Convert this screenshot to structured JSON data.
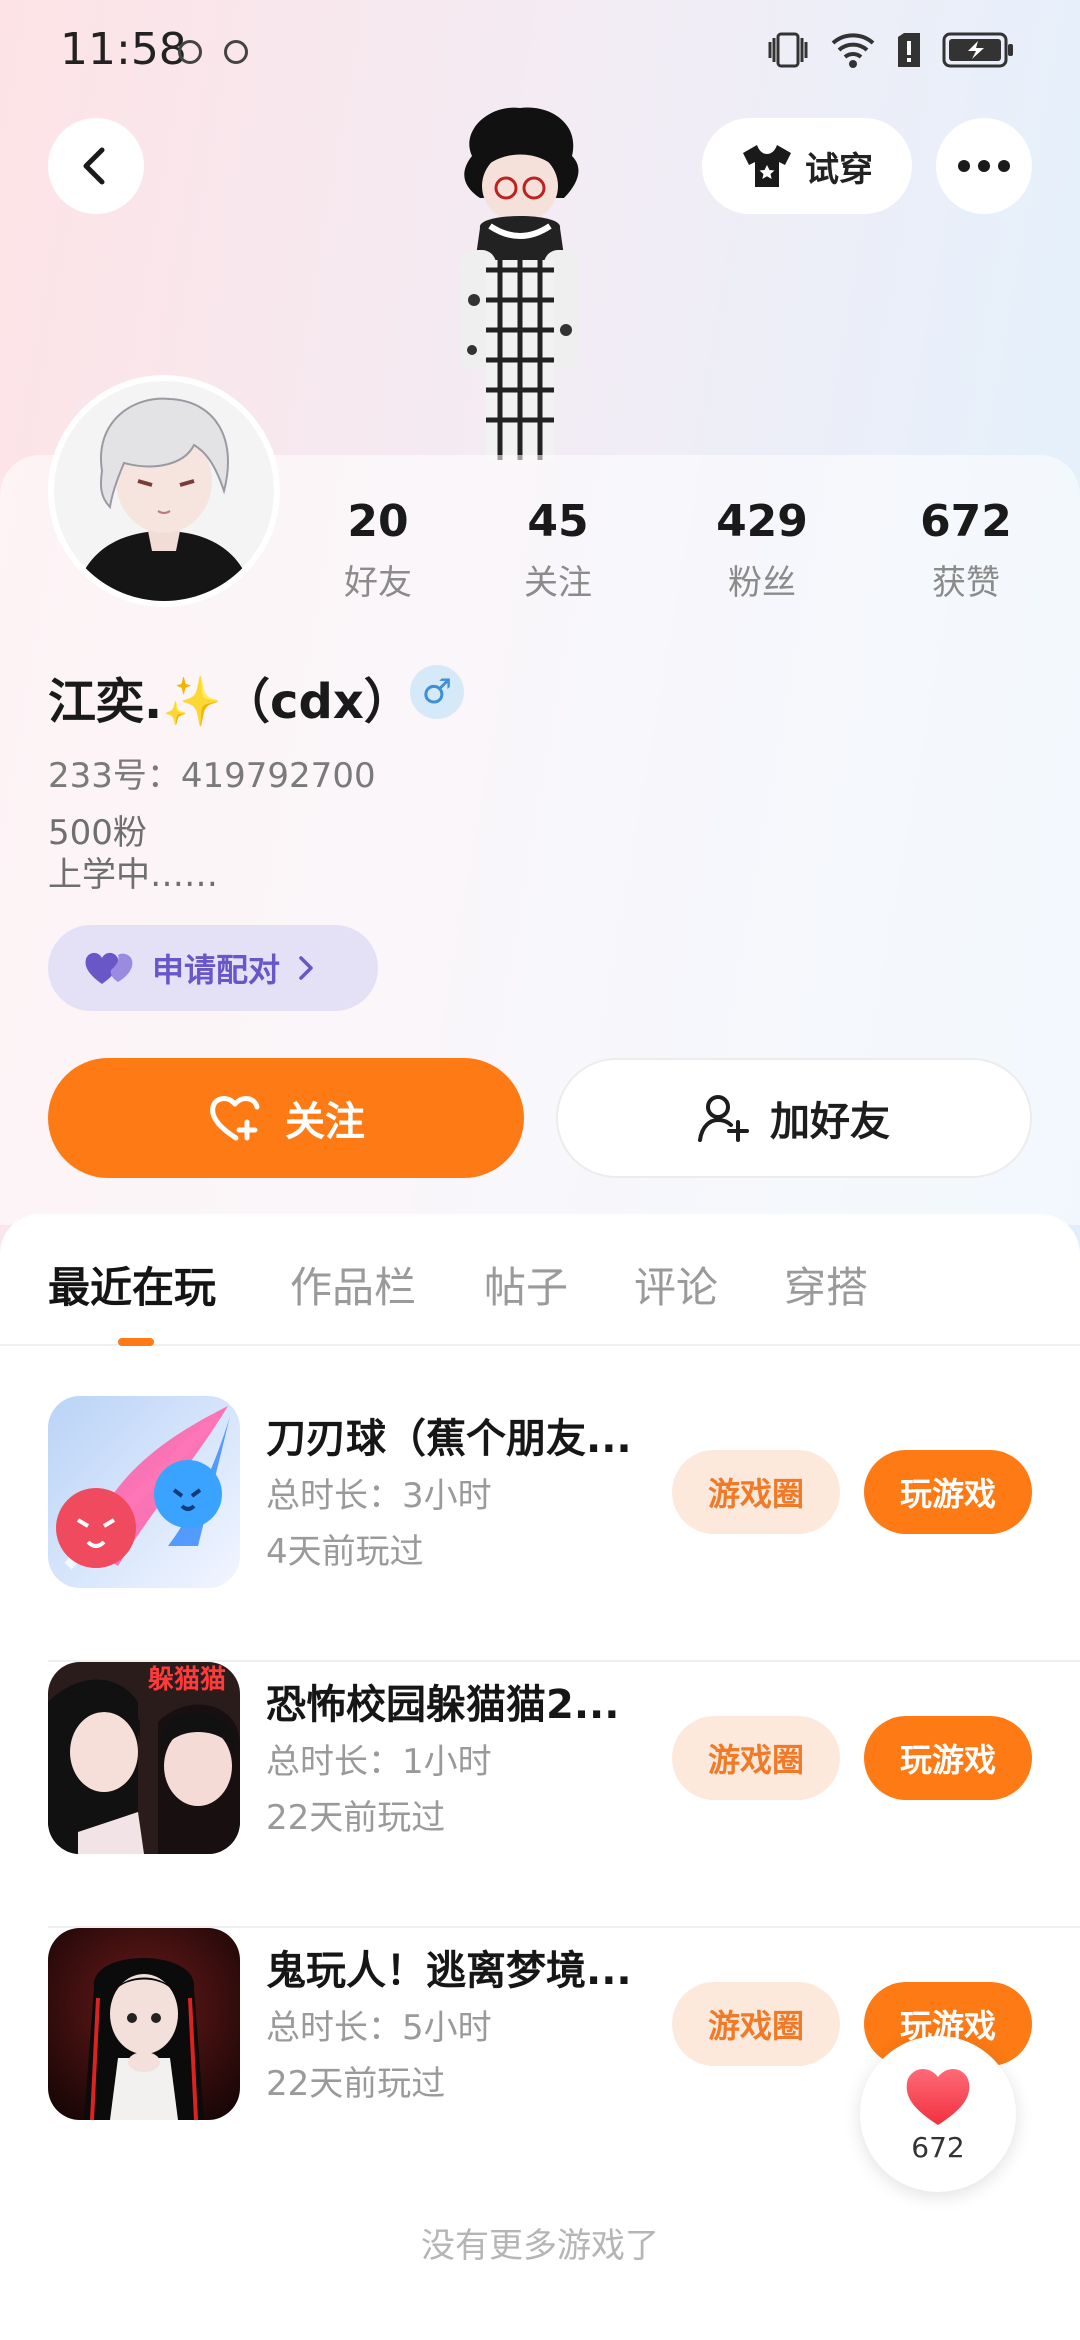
{
  "status_bar": {
    "time": "11:58"
  },
  "header": {
    "try_on_label": "试穿"
  },
  "stats": [
    {
      "value": "20",
      "label": "好友"
    },
    {
      "value": "45",
      "label": "关注"
    },
    {
      "value": "429",
      "label": "粉丝"
    },
    {
      "value": "672",
      "label": "获赞"
    }
  ],
  "profile": {
    "nickname": "江奕.✨（cdx）",
    "gender_symbol": "♂",
    "uid": "233号：419792700",
    "bio_line1": "500粉",
    "bio_line2": "上学中……",
    "pair_label": "申请配对"
  },
  "actions": {
    "follow_label": "关注",
    "add_friend_label": "加好友"
  },
  "tabs": [
    {
      "label": "最近在玩",
      "active": true
    },
    {
      "label": "作品栏",
      "active": false
    },
    {
      "label": "帖子",
      "active": false
    },
    {
      "label": "评论",
      "active": false
    },
    {
      "label": "穿搭",
      "active": false
    }
  ],
  "games": [
    {
      "title": "刀刃球（蕉个朋友...",
      "duration": "总时长：3小时",
      "last_played": "4天前玩过",
      "circle_label": "游戏圈",
      "play_label": "玩游戏"
    },
    {
      "title": "恐怖校园躲猫猫2...",
      "duration": "总时长：1小时",
      "last_played": "22天前玩过",
      "circle_label": "游戏圈",
      "play_label": "玩游戏",
      "icon_text": "躲猫猫"
    },
    {
      "title": "鬼玩人！逃离梦境...",
      "duration": "总时长：5小时",
      "last_played": "22天前玩过",
      "circle_label": "游戏圈",
      "play_label": "玩游戏"
    }
  ],
  "footer": {
    "no_more": "没有更多游戏了"
  },
  "like_fab": {
    "count": "672"
  },
  "colors": {
    "accent": "#fd7a14",
    "accent_light": "#fde9dc",
    "pair_bg": "#e4e0f5",
    "pair_text": "#6957c8"
  }
}
